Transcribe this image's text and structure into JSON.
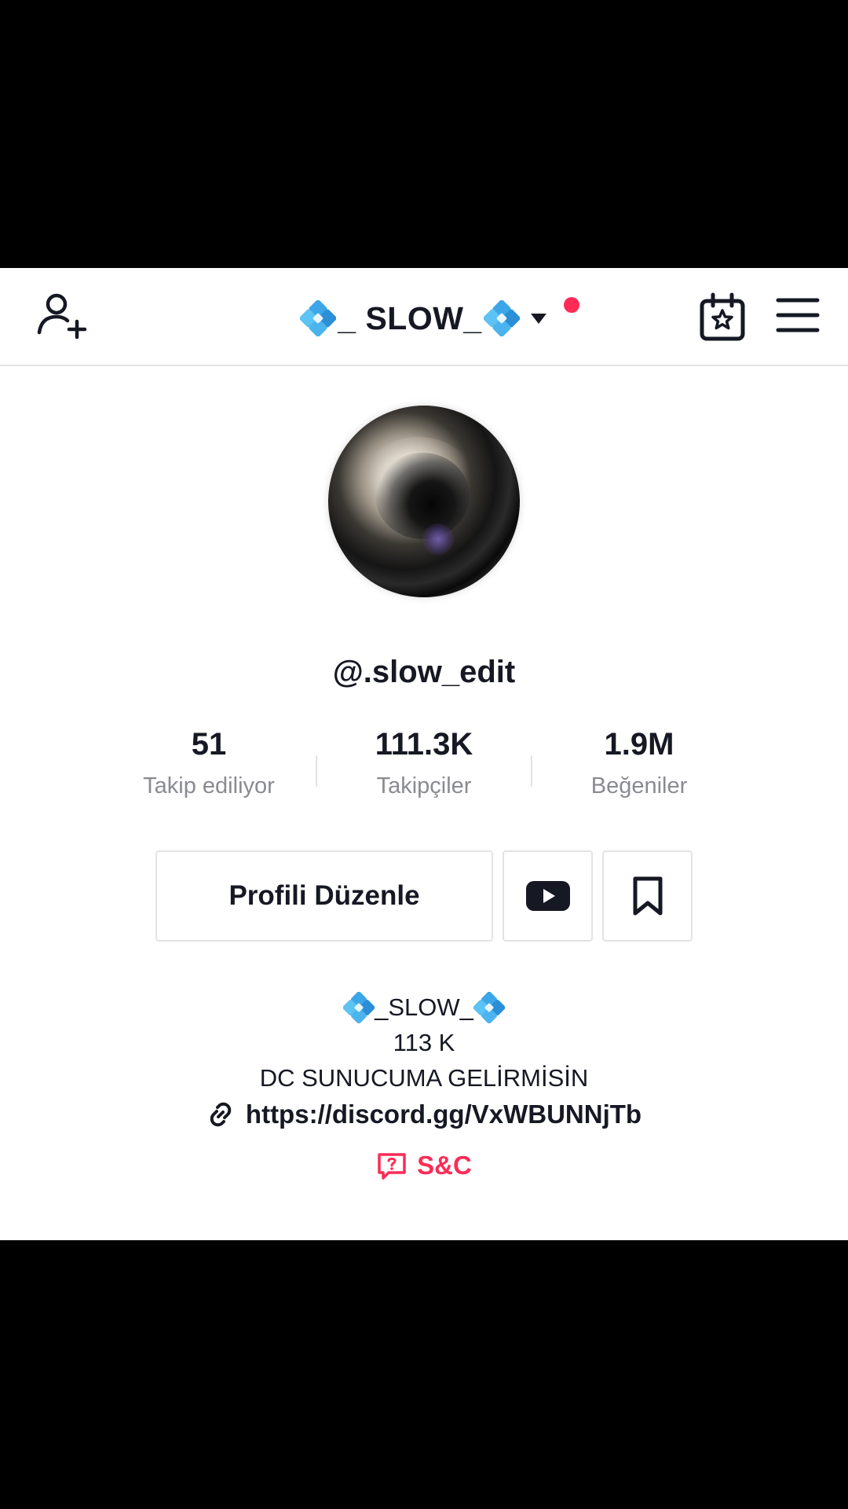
{
  "header": {
    "title": "_ SLOW_",
    "has_notification": true,
    "accent_color": "#fe2c55"
  },
  "profile": {
    "username": "@.slow_edit",
    "stats": [
      {
        "value": "51",
        "label": "Takip ediliyor"
      },
      {
        "value": "111.3K",
        "label": "Takipçiler"
      },
      {
        "value": "1.9M",
        "label": "Beğeniler"
      }
    ],
    "edit_button_label": "Profili Düzenle",
    "bio": {
      "name": "_SLOW_",
      "line2": "113 K",
      "line3": "DC SUNUCUMA GELİRMİSİN"
    },
    "link": "https://discord.gg/VxWBUNNjTb",
    "qa_label": "S&C"
  },
  "icons": {
    "add_user": "add-user-icon",
    "calendar": "calendar-star-icon",
    "menu": "menu-icon",
    "youtube": "youtube-icon",
    "bookmark": "bookmark-icon",
    "link": "link-icon",
    "question_chat": "question-bubble-icon",
    "diamond_emoji": "blue-diamond-icon"
  }
}
